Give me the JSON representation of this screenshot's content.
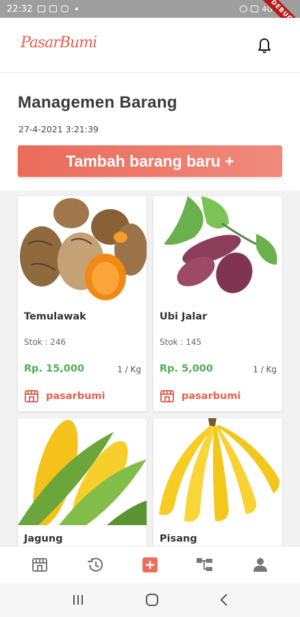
{
  "status_bar": {
    "time": "22:32",
    "extra": "4G"
  },
  "debug_label": "DEBUG",
  "app": {
    "logo_text": "PasarBumi"
  },
  "page": {
    "title": "Managemen Barang",
    "datetime": "27-4-2021 3:21:39",
    "add_button_label": "Tambah barang baru +"
  },
  "products": [
    {
      "name": "Temulawak",
      "stock": "Stok : 246",
      "price": "Rp. 15,000",
      "unit": "1 / Kg",
      "shop": "pasarbumi",
      "image": "temulawak-image"
    },
    {
      "name": "Ubi Jalar",
      "stock": "Stok : 145",
      "price": "Rp. 5,000",
      "unit": "1 / Kg",
      "shop": "pasarbumi",
      "image": "sweet-potato-image"
    },
    {
      "name": "Jagung",
      "stock": "",
      "price": "",
      "unit": "",
      "shop": "",
      "image": "corn-image"
    },
    {
      "name": "Pisang",
      "stock": "",
      "price": "",
      "unit": "",
      "shop": "",
      "image": "banana-image"
    }
  ],
  "bottom_nav": [
    "store-icon",
    "history-icon",
    "add-icon",
    "hierarchy-icon",
    "profile-icon"
  ],
  "colors": {
    "accent": "#e4604d",
    "price": "#4caf50",
    "nav_active": "#ee6c5b"
  }
}
